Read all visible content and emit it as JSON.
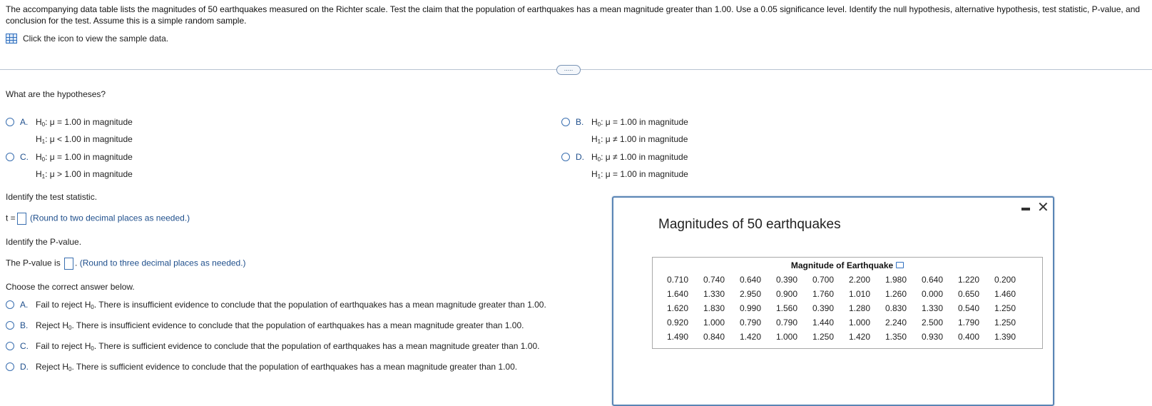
{
  "problem": {
    "text": "The accompanying data table lists the magnitudes of 50 earthquakes measured on the Richter scale. Test the claim that the population of earthquakes has a mean magnitude greater than 1.00. Use a 0.05 significance level. Identify the null hypothesis, alternative hypothesis, test statistic, P-value, and conclusion for the test. Assume this is a simple random sample.",
    "data_link": "Click the icon to view the sample data.",
    "expand_label": "....."
  },
  "hypotheses": {
    "question": "What are the hypotheses?",
    "options": [
      {
        "letter": "A.",
        "h0": "μ = 1.00 in magnitude",
        "h1": "μ < 1.00 in magnitude"
      },
      {
        "letter": "B.",
        "h0": "μ = 1.00 in magnitude",
        "h1": "μ ≠ 1.00 in magnitude"
      },
      {
        "letter": "C.",
        "h0": "μ = 1.00 in magnitude",
        "h1": "μ > 1.00 in magnitude"
      },
      {
        "letter": "D.",
        "h0": "μ ≠ 1.00 in magnitude",
        "h1": "μ = 1.00 in magnitude"
      }
    ]
  },
  "test_statistic": {
    "question": "Identify the test statistic.",
    "prefix": "t =",
    "hint": "(Round to two decimal places as needed.)"
  },
  "p_value": {
    "question": "Identify the P-value.",
    "prefix": "The P-value is",
    "suffix": ".",
    "hint": "(Round to three decimal places as needed.)"
  },
  "conclusion": {
    "question": "Choose the correct answer below.",
    "options": [
      {
        "letter": "A.",
        "action": "Fail to reject H",
        "text": ". There is insufficient evidence to conclude that the population of earthquakes has a mean magnitude greater than 1.00."
      },
      {
        "letter": "B.",
        "action": "Reject H",
        "text": ". There is insufficient evidence to conclude that the population of earthquakes has a mean magnitude greater than 1.00."
      },
      {
        "letter": "C.",
        "action": "Fail to reject H",
        "text": ". There is sufficient evidence to conclude that the population of earthquakes has a mean magnitude greater than 1.00."
      },
      {
        "letter": "D.",
        "action": "Reject H",
        "text": ". There is sufficient evidence to conclude that the population of earthquakes has a mean magnitude greater than 1.00."
      }
    ]
  },
  "dialog": {
    "title": "Magnitudes of 50 earthquakes",
    "close_glyph": "✕",
    "table_header": "Magnitude of Earthquake",
    "rows": [
      [
        "0.710",
        "0.740",
        "0.640",
        "0.390",
        "0.700",
        "2.200",
        "1.980",
        "0.640",
        "1.220",
        "0.200"
      ],
      [
        "1.640",
        "1.330",
        "2.950",
        "0.900",
        "1.760",
        "1.010",
        "1.260",
        "0.000",
        "0.650",
        "1.460"
      ],
      [
        "1.620",
        "1.830",
        "0.990",
        "1.560",
        "0.390",
        "1.280",
        "0.830",
        "1.330",
        "0.540",
        "1.250"
      ],
      [
        "0.920",
        "1.000",
        "0.790",
        "0.790",
        "1.440",
        "1.000",
        "2.240",
        "2.500",
        "1.790",
        "1.250"
      ],
      [
        "1.490",
        "0.840",
        "1.420",
        "1.000",
        "1.250",
        "1.420",
        "1.350",
        "0.930",
        "0.400",
        "1.390"
      ]
    ]
  },
  "colors": {
    "accent": "#1f4f8c",
    "radio_border": "#3a6fb0",
    "dialog_border": "#5a85b5"
  }
}
